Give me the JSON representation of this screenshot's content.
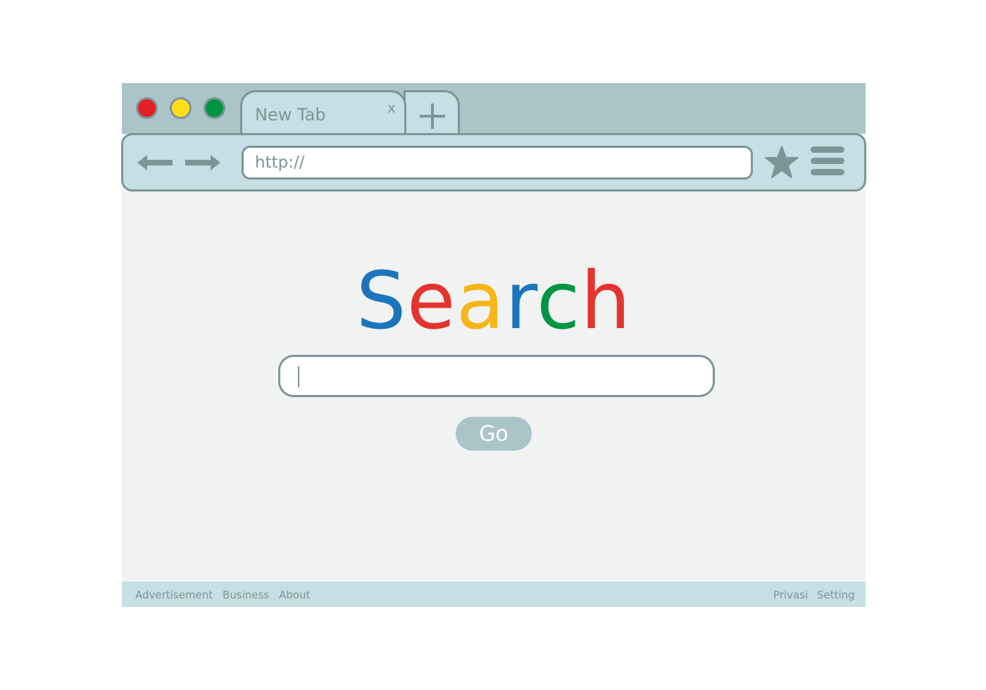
{
  "window": {
    "traffic_lights": [
      {
        "name": "close",
        "color": "#e31e24"
      },
      {
        "name": "minimize",
        "color": "#ffde17"
      },
      {
        "name": "maximize",
        "color": "#009444"
      }
    ]
  },
  "tab": {
    "label": "New Tab",
    "close_glyph": "x",
    "new_tab_icon": "plus-icon"
  },
  "toolbar": {
    "back_icon": "arrow-left-icon",
    "forward_icon": "arrow-right-icon",
    "url_value": "http://",
    "bookmark_icon": "star-icon",
    "menu_icon": "hamburger-menu-icon"
  },
  "main": {
    "logo_letters": [
      {
        "char": "S",
        "color": "#1c75bc"
      },
      {
        "char": "e",
        "color": "#e3342f"
      },
      {
        "char": "a",
        "color": "#f7b519"
      },
      {
        "char": "r",
        "color": "#1c75bc"
      },
      {
        "char": "c",
        "color": "#009444"
      },
      {
        "char": "h",
        "color": "#e3342f"
      }
    ],
    "search_value": "",
    "go_label": "Go"
  },
  "footer": {
    "left_links": [
      "Advertisement",
      "Business",
      "About"
    ],
    "right_links": [
      "Privasi",
      "Setting"
    ]
  },
  "colors": {
    "frame": "#aac4c8",
    "chrome": "#c6dfe4",
    "outline": "#7d9598",
    "content_bg": "#f1f2f2"
  }
}
